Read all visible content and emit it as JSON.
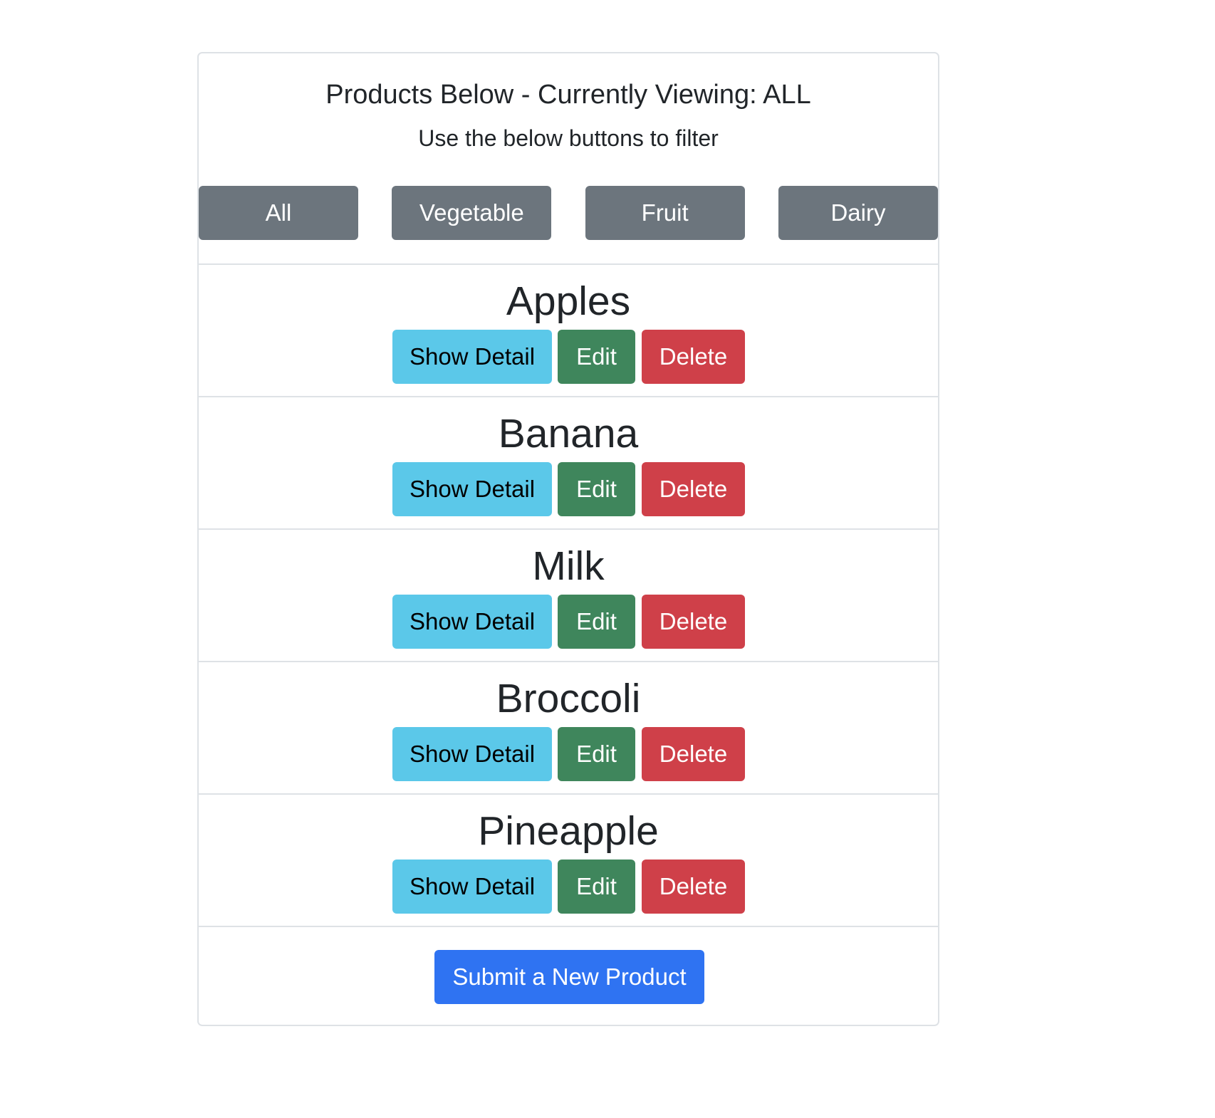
{
  "header": {
    "title": "Products Below - Currently Viewing: ALL",
    "subtitle": "Use the below buttons to filter"
  },
  "filters": {
    "all": "All",
    "vegetable": "Vegetable",
    "fruit": "Fruit",
    "dairy": "Dairy"
  },
  "products": [
    {
      "name": "Apples"
    },
    {
      "name": "Banana"
    },
    {
      "name": "Milk"
    },
    {
      "name": "Broccoli"
    },
    {
      "name": "Pineapple"
    }
  ],
  "actions": {
    "show_detail": "Show Detail",
    "edit": "Edit",
    "delete": "Delete"
  },
  "footer": {
    "submit_label": "Submit a New Product"
  },
  "colors": {
    "filter": "#6c757d",
    "detail": "#5bc8e9",
    "edit": "#3f865c",
    "delete": "#cf4049",
    "submit": "#2f73f2"
  }
}
